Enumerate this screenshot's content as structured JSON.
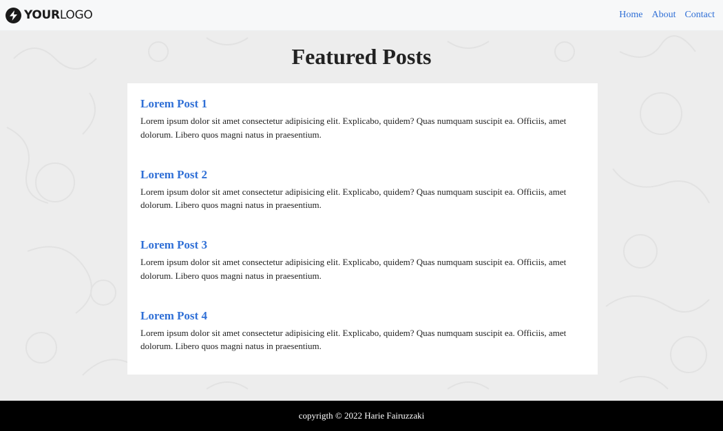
{
  "header": {
    "logo": {
      "bold": "YOUR",
      "light": "LOGO"
    },
    "nav": [
      {
        "label": "Home"
      },
      {
        "label": "About"
      },
      {
        "label": "Contact"
      }
    ]
  },
  "main": {
    "title": "Featured Posts",
    "posts": [
      {
        "title": "Lorem Post 1",
        "body": "Lorem ipsum dolor sit amet consectetur adipisicing elit. Explicabo, quidem? Quas numquam suscipit ea. Officiis, amet dolorum. Libero quos magni natus in praesentium."
      },
      {
        "title": "Lorem Post 2",
        "body": "Lorem ipsum dolor sit amet consectetur adipisicing elit. Explicabo, quidem? Quas numquam suscipit ea. Officiis, amet dolorum. Libero quos magni natus in praesentium."
      },
      {
        "title": "Lorem Post 3",
        "body": "Lorem ipsum dolor sit amet consectetur adipisicing elit. Explicabo, quidem? Quas numquam suscipit ea. Officiis, amet dolorum. Libero quos magni natus in praesentium."
      },
      {
        "title": "Lorem Post 4",
        "body": "Lorem ipsum dolor sit amet consectetur adipisicing elit. Explicabo, quidem? Quas numquam suscipit ea. Officiis, amet dolorum. Libero quos magni natus in praesentium."
      }
    ]
  },
  "footer": {
    "text": "copyrigth © 2022 Harie Fairuzzaki"
  },
  "colors": {
    "link": "#2f6fd6",
    "page_bg": "#ededed",
    "footer_bg": "#000000"
  },
  "icons": {
    "logo_mark": "lightning-bolt-icon"
  }
}
